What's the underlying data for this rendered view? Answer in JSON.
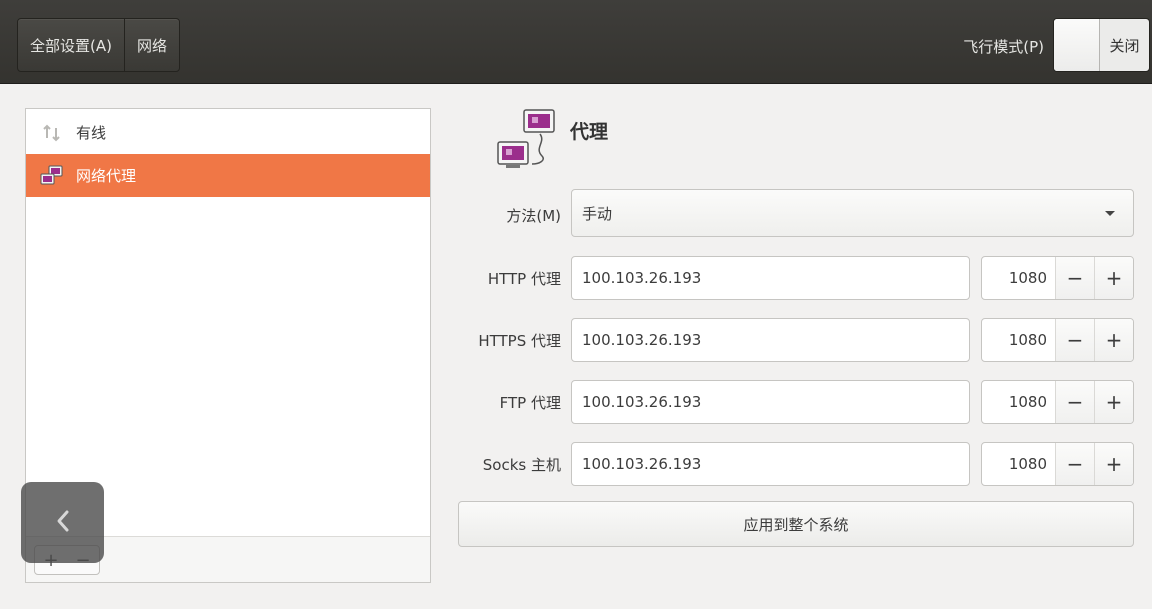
{
  "header": {
    "breadcrumbs": [
      "全部设置(A)",
      "网络"
    ],
    "airplane_label": "飞行模式(P)",
    "airplane_switch_state": "关闭"
  },
  "sidebar": {
    "items": [
      {
        "label": "有线",
        "icon": "network-wired-icon",
        "selected": false
      },
      {
        "label": "网络代理",
        "icon": "network-proxy-icon",
        "selected": true
      }
    ],
    "footer": {
      "add": "+",
      "remove": "−"
    }
  },
  "proxy": {
    "title": "代理",
    "method": {
      "label": "方法(M)",
      "value": "手动"
    },
    "rows": [
      {
        "label": "HTTP 代理",
        "host": "100.103.26.193",
        "port": "1080"
      },
      {
        "label": "HTTPS 代理",
        "host": "100.103.26.193",
        "port": "1080"
      },
      {
        "label": "FTP 代理",
        "host": "100.103.26.193",
        "port": "1080"
      },
      {
        "label": "Socks 主机",
        "host": "100.103.26.193",
        "port": "1080"
      }
    ],
    "apply_label": "应用到整个系统"
  },
  "colors": {
    "accent": "#f07746",
    "header_bg": "#3a3935"
  }
}
